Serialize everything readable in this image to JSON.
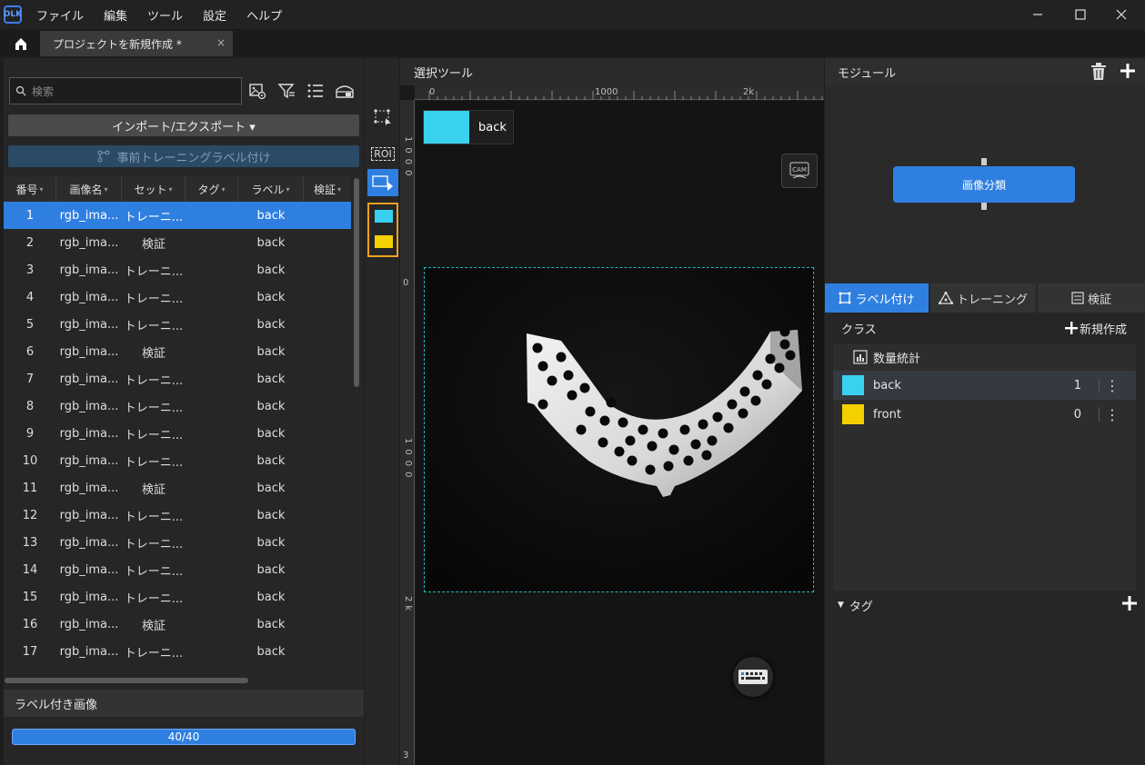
{
  "app": {
    "logo_text": "DLK"
  },
  "menu": [
    "ファイル",
    "編集",
    "ツール",
    "設定",
    "ヘルプ"
  ],
  "tabs": {
    "project": "プロジェクトを新規作成 *",
    "close": "×"
  },
  "left": {
    "search_placeholder": "検索",
    "import_label": "インポート/エクスポート ▾",
    "pretrain_label": "事前トレーニングラベル付け",
    "columns": [
      "番号",
      "画像名",
      "セット",
      "タグ",
      "ラベル",
      "検証"
    ],
    "rows": [
      {
        "no": "1",
        "name": "rgb_ima...",
        "set": "トレーニ...",
        "tag": "",
        "label": "back",
        "selected": true
      },
      {
        "no": "2",
        "name": "rgb_ima...",
        "set": "検証",
        "tag": "",
        "label": "back"
      },
      {
        "no": "3",
        "name": "rgb_ima...",
        "set": "トレーニ...",
        "tag": "",
        "label": "back"
      },
      {
        "no": "4",
        "name": "rgb_ima...",
        "set": "トレーニ...",
        "tag": "",
        "label": "back"
      },
      {
        "no": "5",
        "name": "rgb_ima...",
        "set": "トレーニ...",
        "tag": "",
        "label": "back"
      },
      {
        "no": "6",
        "name": "rgb_ima...",
        "set": "検証",
        "tag": "",
        "label": "back"
      },
      {
        "no": "7",
        "name": "rgb_ima...",
        "set": "トレーニ...",
        "tag": "",
        "label": "back"
      },
      {
        "no": "8",
        "name": "rgb_ima...",
        "set": "トレーニ...",
        "tag": "",
        "label": "back"
      },
      {
        "no": "9",
        "name": "rgb_ima...",
        "set": "トレーニ...",
        "tag": "",
        "label": "back"
      },
      {
        "no": "10",
        "name": "rgb_ima...",
        "set": "トレーニ...",
        "tag": "",
        "label": "back"
      },
      {
        "no": "11",
        "name": "rgb_ima...",
        "set": "検証",
        "tag": "",
        "label": "back"
      },
      {
        "no": "12",
        "name": "rgb_ima...",
        "set": "トレーニ...",
        "tag": "",
        "label": "back"
      },
      {
        "no": "13",
        "name": "rgb_ima...",
        "set": "トレーニ...",
        "tag": "",
        "label": "back"
      },
      {
        "no": "14",
        "name": "rgb_ima...",
        "set": "トレーニ...",
        "tag": "",
        "label": "back"
      },
      {
        "no": "15",
        "name": "rgb_ima...",
        "set": "トレーニ...",
        "tag": "",
        "label": "back"
      },
      {
        "no": "16",
        "name": "rgb_ima...",
        "set": "検証",
        "tag": "",
        "label": "back"
      },
      {
        "no": "17",
        "name": "rgb_ima...",
        "set": "トレーニ...",
        "tag": "",
        "label": "back"
      }
    ],
    "labeled_title": "ラベル付き画像",
    "progress_text": "40/40",
    "progress_fraction": 1.0
  },
  "toolbar": {
    "roi_label": "ROI"
  },
  "canvas": {
    "title": "選択ツール",
    "ruler_h": [
      "0",
      "1000",
      "2k"
    ],
    "ruler_v": [
      "1000",
      "0",
      "1000",
      "2k",
      "3"
    ],
    "class_chip": "back",
    "cam_label": "CAM"
  },
  "right": {
    "module_title": "モジュール",
    "module_node": "画像分類",
    "tabs": [
      "ラベル付け",
      "トレーニング",
      "検証"
    ],
    "class_title": "クラス",
    "new_class": "新規作成",
    "stats": "数量統計",
    "classes": [
      {
        "name": "back",
        "count": "1",
        "color": "#3ad0f0",
        "active": true
      },
      {
        "name": "front",
        "count": "0",
        "color": "#f5d000",
        "active": false
      }
    ],
    "tags_title": "タグ"
  },
  "colors": {
    "accent": "#2f7fe0",
    "back": "#3ad0f0",
    "front": "#f5d000",
    "roi_border": "#25b9b9",
    "highlight": "#f0a020"
  }
}
